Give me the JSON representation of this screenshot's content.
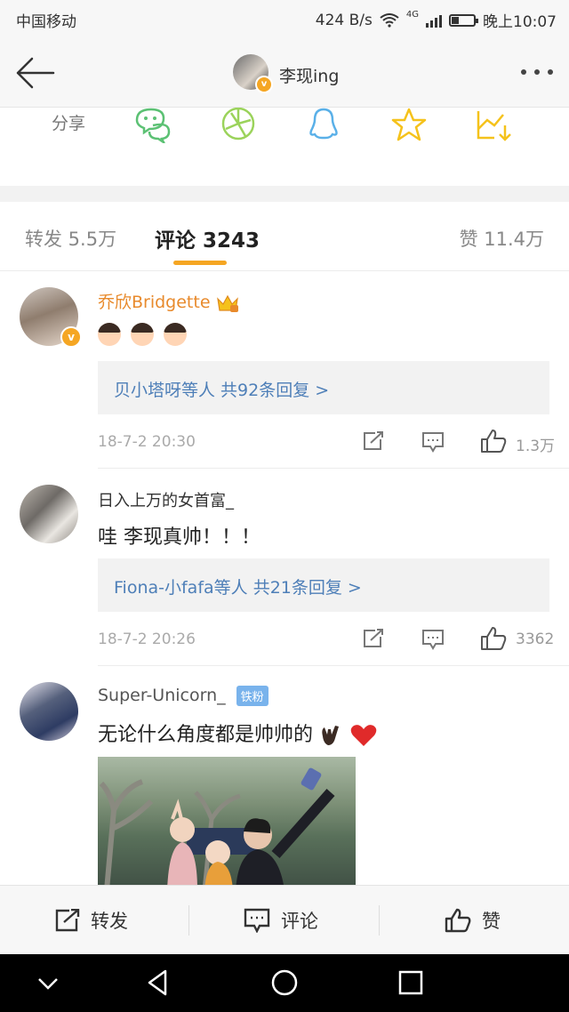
{
  "status_bar": {
    "carrier": "中国移动",
    "speed": "424 B/s",
    "network": "4G",
    "time": "晚上10:07"
  },
  "nav": {
    "title": "李现ing",
    "avatar_badge": "v"
  },
  "share": {
    "label": "分享",
    "icons": [
      "wechat-icon",
      "moments-icon",
      "qq-icon",
      "qzone-icon",
      "save-icon"
    ]
  },
  "tabs": {
    "repost": "转发 5.5万",
    "comments": "评论 3243",
    "likes": "赞 11.4万"
  },
  "comments": [
    {
      "username": "乔欣Bridgette",
      "text": "",
      "reply_summary": "贝小塔呀等人 共92条回复 >",
      "date": "18-7-2 20:30",
      "likes": "1.3万"
    },
    {
      "username": "日入上万的女首富_",
      "text": "哇 李现真帅！！！",
      "reply_summary": "Fiona-小fafa等人 共21条回复 >",
      "date": "18-7-2 20:26",
      "likes": "3362"
    },
    {
      "username": "Super-Unicorn_",
      "badge": "铁粉",
      "text": "无论什么角度都是帅帅的"
    }
  ],
  "action_bar": {
    "repost": "转发",
    "comment": "评论",
    "like": "赞"
  },
  "colors": {
    "accent": "#f5a623",
    "link": "#4e7fb8",
    "share_green": "#5cc174",
    "share_lime": "#9bd35b",
    "share_blue": "#5ab0e8",
    "share_yellow": "#f5c21b"
  }
}
